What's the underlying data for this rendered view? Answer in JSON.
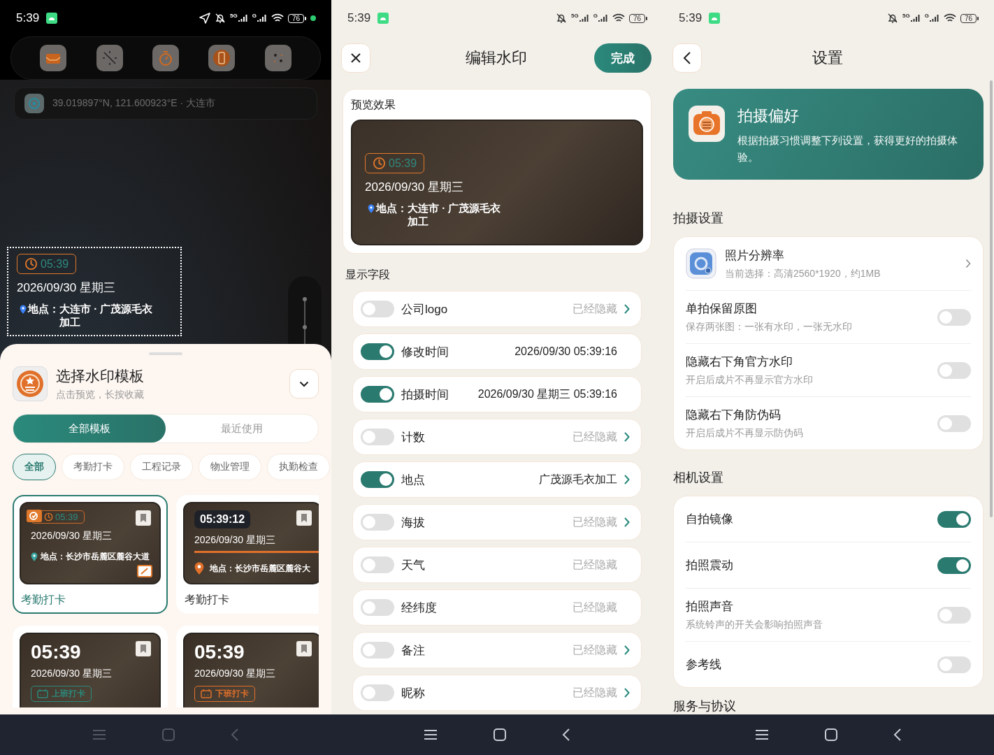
{
  "camera_screen": {
    "status_bar": {
      "time": "5:39",
      "network_1": "5G",
      "network_2": "G",
      "battery": "76"
    },
    "location_bar": {
      "text": "39.019897°N, 121.600923°E · 大连市"
    },
    "watermark": {
      "time": "05:39",
      "date": "2026/09/30 星期三",
      "location_label": "地点：",
      "location": "大连市 · 广茂源毛衣加工"
    },
    "sheet": {
      "title": "选择水印模板",
      "subtitle": "点击预览，长按收藏",
      "tabs": [
        {
          "label": "全部模板",
          "selected": true
        },
        {
          "label": "最近使用",
          "selected": false
        }
      ],
      "categories": [
        {
          "label": "全部",
          "selected": true
        },
        {
          "label": "考勤打卡",
          "selected": false
        },
        {
          "label": "工程记录",
          "selected": false
        },
        {
          "label": "物业管理",
          "selected": false
        },
        {
          "label": "执勤检查",
          "selected": false
        }
      ],
      "templates": [
        {
          "kind": "clock-badge",
          "selected": true,
          "time": "05:39",
          "date": "2026/09/30 星期三",
          "location": "地点：长沙市岳麓区麓谷大道",
          "name": "考勤打卡"
        },
        {
          "kind": "time-bar",
          "selected": false,
          "time": "05:39:12",
          "date": "2026/09/30 星期三",
          "location": "地点：长沙市岳麓区麓谷大",
          "name": "考勤打卡"
        },
        {
          "kind": "big-time",
          "selected": false,
          "time": "05:39",
          "date": "2026/09/30 星期三",
          "tag": "上班打卡",
          "color": "#2a8a7c"
        },
        {
          "kind": "big-time",
          "selected": false,
          "time": "05:39",
          "date": "2026/09/30 星期三",
          "tag": "下班打卡",
          "color": "#e0702a"
        }
      ]
    }
  },
  "edit_screen": {
    "status_bar": {
      "time": "5:39",
      "network_1": "5G",
      "network_2": "G",
      "battery": "76"
    },
    "title": "编辑水印",
    "done_button": "完成",
    "preview": {
      "heading": "预览效果",
      "time": "05:39",
      "date": "2026/09/30 星期三",
      "location_label": "地点：",
      "location": "大连市 · 广茂源毛衣加工"
    },
    "fields_heading": "显示字段",
    "fields": [
      {
        "label": "公司logo",
        "on": false,
        "value": "已经隐藏",
        "arrow": true
      },
      {
        "label": "修改时间",
        "on": true,
        "value": "2026/09/30 05:39:16",
        "arrow": false
      },
      {
        "label": "拍摄时间",
        "on": true,
        "value": "2026/09/30 星期三 05:39:16",
        "arrow": false
      },
      {
        "label": "计数",
        "on": false,
        "value": "已经隐藏",
        "arrow": true
      },
      {
        "label": "地点",
        "on": true,
        "value": "广茂源毛衣加工",
        "arrow": true
      },
      {
        "label": "海拔",
        "on": false,
        "value": "已经隐藏",
        "arrow": true
      },
      {
        "label": "天气",
        "on": false,
        "value": "已经隐藏",
        "arrow": false
      },
      {
        "label": "经纬度",
        "on": false,
        "value": "已经隐藏",
        "arrow": false
      },
      {
        "label": "备注",
        "on": false,
        "value": "已经隐藏",
        "arrow": true
      },
      {
        "label": "昵称",
        "on": false,
        "value": "已经隐藏",
        "arrow": true
      }
    ]
  },
  "settings_screen": {
    "status_bar": {
      "time": "5:39",
      "network_1": "5G",
      "network_2": "G",
      "battery": "76"
    },
    "title": "设置",
    "banner": {
      "title": "拍摄偏好",
      "text": "根据拍摄习惯调整下列设置，获得更好的拍摄体验。"
    },
    "sections": [
      {
        "heading": "拍摄设置",
        "items": [
          {
            "kind": "link",
            "title": "照片分辨率",
            "subtitle": "当前选择：高清2560*1920，约1MB"
          },
          {
            "kind": "toggle",
            "title": "单拍保留原图",
            "subtitle": "保存两张图：一张有水印，一张无水印",
            "on": false
          },
          {
            "kind": "toggle",
            "title": "隐藏右下角官方水印",
            "subtitle": "开启后成片不再显示官方水印",
            "on": false
          },
          {
            "kind": "toggle",
            "title": "隐藏右下角防伪码",
            "subtitle": "开启后成片不再显示防伪码",
            "on": false
          }
        ]
      },
      {
        "heading": "相机设置",
        "items": [
          {
            "kind": "toggle",
            "title": "自拍镜像",
            "on": true
          },
          {
            "kind": "toggle",
            "title": "拍照震动",
            "on": true
          },
          {
            "kind": "toggle",
            "title": "拍照声音",
            "subtitle": "系统铃声的开关会影响拍照声音",
            "on": false
          },
          {
            "kind": "toggle",
            "title": "参考线",
            "on": false
          }
        ]
      },
      {
        "heading": "服务与协议"
      }
    ]
  }
}
